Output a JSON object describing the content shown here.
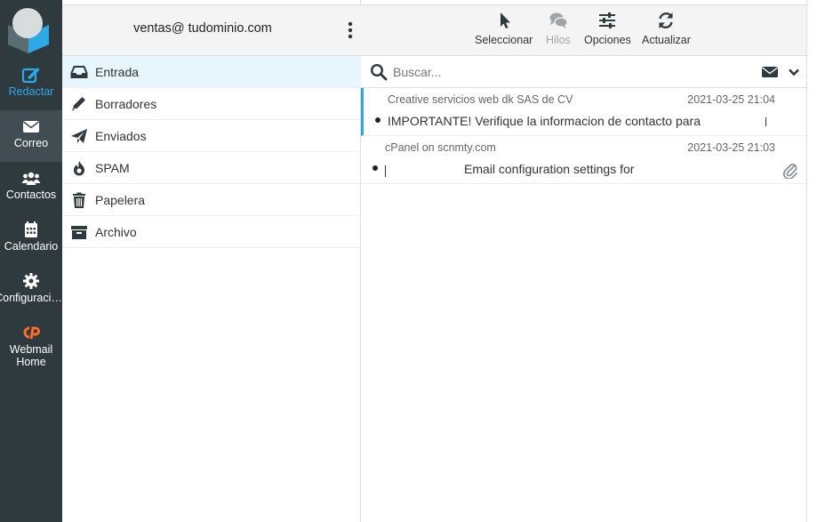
{
  "nav": {
    "items": [
      {
        "label": "Redactar",
        "icon": "compose-icon"
      },
      {
        "label": "Correo",
        "icon": "envelope-icon"
      },
      {
        "label": "Contactos",
        "icon": "users-icon"
      },
      {
        "label": "Calendario",
        "icon": "calendar-icon"
      },
      {
        "label": "Configuraci…",
        "icon": "gear-icon"
      },
      {
        "label": "Webmail Home",
        "icon": "cpanel-icon"
      }
    ],
    "accent": "#2fa8e6",
    "cpanel_color": "#ff6c2c"
  },
  "account": {
    "email": "ventas@ tudominio.com"
  },
  "folders": [
    {
      "label": "Entrada",
      "icon": "inbox-icon"
    },
    {
      "label": "Borradores",
      "icon": "pencil-icon"
    },
    {
      "label": "Enviados",
      "icon": "paper-plane-icon"
    },
    {
      "label": "SPAM",
      "icon": "fire-icon"
    },
    {
      "label": "Papelera",
      "icon": "trash-icon"
    },
    {
      "label": "Archivo",
      "icon": "archive-icon"
    }
  ],
  "toolbar": {
    "select": "Seleccionar",
    "threads": "Hilos",
    "options": "Opciones",
    "refresh": "Actualizar"
  },
  "search": {
    "placeholder": "Buscar..."
  },
  "messages": [
    {
      "from": "Creative servicios web dk SAS de CV",
      "date": "2021-03-25 21:04",
      "subject": "IMPORTANTE! Verifique la informacion de contacto para"
    },
    {
      "from": "cPanel on scnmty.com",
      "date": "2021-03-25 21:03",
      "subject": "Email configuration settings for"
    }
  ]
}
